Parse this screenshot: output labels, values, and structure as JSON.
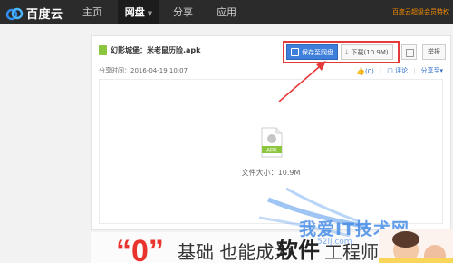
{
  "nav": {
    "logo": "百度云",
    "items": [
      {
        "label": "主页"
      },
      {
        "label": "网盘"
      },
      {
        "label": "分享"
      },
      {
        "label": "应用"
      }
    ],
    "promo": "百度云超级会员特权"
  },
  "file": {
    "name": "幻影城堡：米老鼠历险.apk",
    "share_time_label": "分享时间：",
    "share_time": "2016-04-19 10:07",
    "type_badge": "APK",
    "size_label": "文件大小：",
    "size": "10.9M"
  },
  "buttons": {
    "save": "保存至网盘",
    "download": "下载(10.9M)",
    "report": "举报"
  },
  "actions": {
    "like": "(0)",
    "comment": "评论",
    "share": "分享至"
  },
  "banner": {
    "zero": "“0”",
    "text1": "基础 也能成为",
    "text2": "软件",
    "text3": "工程师"
  },
  "watermark": {
    "text": "我爱IT技术网",
    "url": "52ij.com"
  },
  "colors": {
    "nav_bg": "#2b2b2b",
    "save_button": "#3f7fdc",
    "highlight": "#e53a3a",
    "apk_green": "#8cc63f",
    "link_blue": "#2a6bc9"
  }
}
